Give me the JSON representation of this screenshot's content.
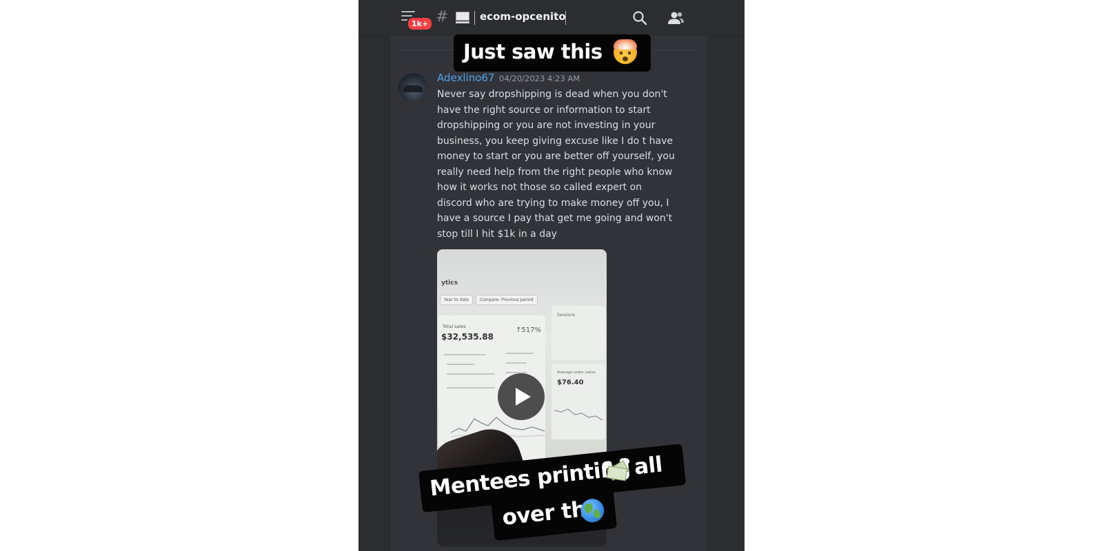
{
  "header": {
    "badge": "1k+",
    "hash_symbol": "#",
    "channel_name": "ecom-opcenito",
    "icons": [
      "menu-icon",
      "laptop-icon",
      "search-icon",
      "members-icon"
    ]
  },
  "message": {
    "username": "Adexlino67",
    "timestamp": "04/20/2023 4:23 AM",
    "text": "Never say dropshipping is dead when you don't\nhave the right source or information to start\ndropshipping or you are not investing in your\nbusiness, you keep giving excuse like I do t have\nmoney to start or you are better off yourself, you\nreally need help from the right people who know\nhow it works not those so called expert on\ndiscord who are trying to make money off you, I\nhave a source I pay that get me going and won't\nstop till I hit $1k in a day",
    "username_color": "#4ea1e8"
  },
  "video": {
    "title": "ytics",
    "chip_left": "Year to date",
    "chip_right": "Compare: Previous period",
    "total_label": "Total sales",
    "total_value": "$32,535.88",
    "percent": "↑517%",
    "sessions_label": "Sessions",
    "aov_label": "Average order value",
    "aov_value": "$76.40",
    "play_icon": "play-icon"
  },
  "stickers": {
    "top_text": "Just saw this",
    "top_emoji": "exploding-head-emoji",
    "bottom_line1_a": "Mentees printing",
    "bottom_line1_emoji": "money-with-wings-emoji",
    "bottom_line1_b": "all",
    "bottom_line2_a": "over the",
    "bottom_line2_emoji": "globe-emoji"
  },
  "colors": {
    "background": "#313338",
    "header_bg": "#2b2d31",
    "badge": "#f23f43",
    "text": "#dbdee1",
    "timestamp": "#949ba4"
  }
}
